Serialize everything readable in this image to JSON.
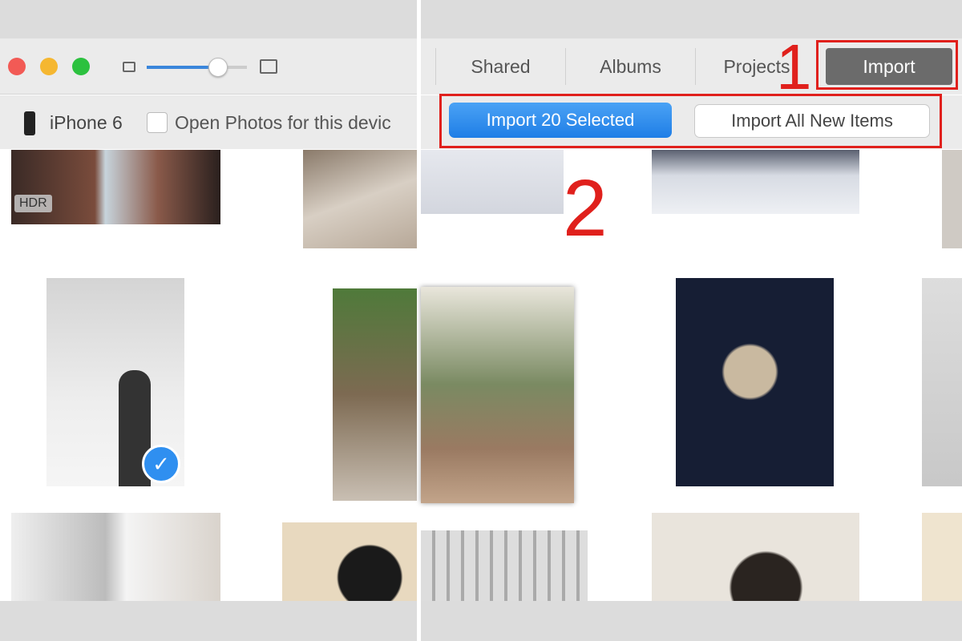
{
  "left": {
    "zoom_slider": {
      "value_percent": 75
    },
    "device_name": "iPhone 6",
    "open_photos_label": "Open Photos for this devic",
    "hdr_badge": "HDR",
    "selected_check": true
  },
  "right": {
    "tabs": [
      {
        "label": "Shared"
      },
      {
        "label": "Albums"
      },
      {
        "label": "Projects"
      },
      {
        "label": "Import",
        "selected": true
      }
    ],
    "import_selected_label": "Import 20 Selected",
    "import_all_label": "Import All New Items",
    "annotations": {
      "step1": "1",
      "step2": "2"
    }
  },
  "colors": {
    "accent_blue": "#2f8ff0",
    "annotation_red": "#e0201c",
    "tab_selected": "#6b6b6b"
  }
}
